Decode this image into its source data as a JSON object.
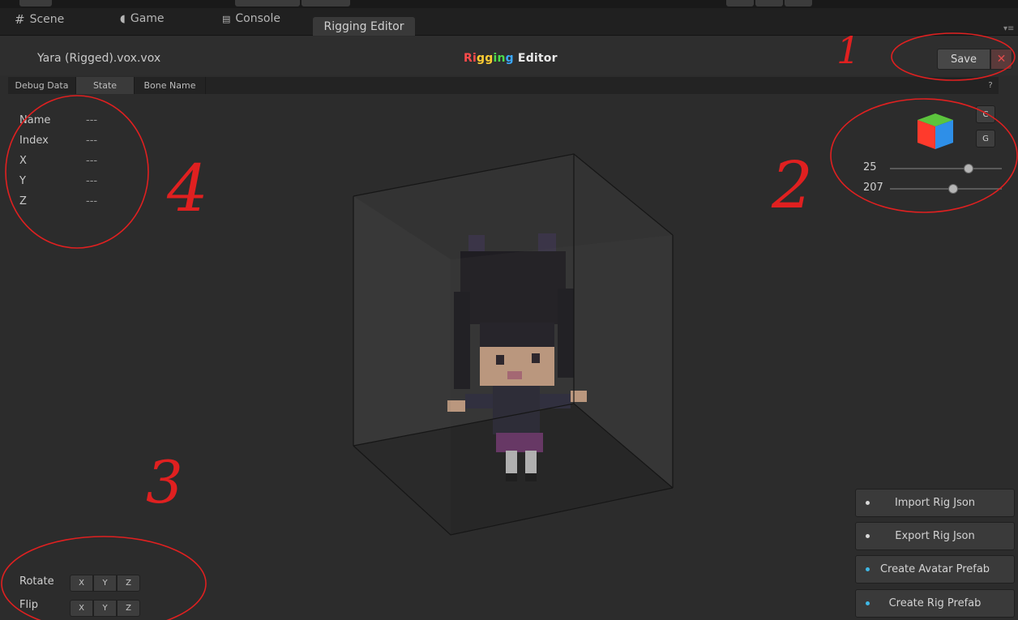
{
  "tabs": {
    "scene": "Scene",
    "game": "Game",
    "console": "Console",
    "rigging_editor": "Rigging Editor"
  },
  "header": {
    "filename": "Yara (Rigged).vox.vox",
    "title_part1": "Rigging",
    "title_part2": " Editor",
    "save_label": "Save",
    "close_label": "✕"
  },
  "subtabs": {
    "debug_data": "Debug Data",
    "state": "State",
    "bone_name": "Bone Name",
    "help": "?"
  },
  "info": {
    "name_label": "Name",
    "name_value": "---",
    "index_label": "Index",
    "index_value": "---",
    "x_label": "X",
    "x_value": "---",
    "y_label": "Y",
    "y_value": "---",
    "z_label": "Z",
    "z_value": "---"
  },
  "view_controls": {
    "c_label": "C",
    "g_label": "G",
    "slider1_value": "25",
    "slider1_level": 0.72,
    "slider2_value": "207",
    "slider2_level": 0.57
  },
  "actions": {
    "import_rig_json": "Import Rig Json",
    "export_rig_json": "Export Rig Json",
    "create_avatar_prefab": "Create Avatar Prefab",
    "create_rig_prefab": "Create Rig Prefab"
  },
  "transform": {
    "rotate_label": "Rotate",
    "flip_label": "Flip",
    "x": "X",
    "y": "Y",
    "z": "Z"
  },
  "annotations": {
    "n1": "1",
    "n2": "2",
    "n3": "3",
    "n4": "4"
  },
  "colors": {
    "rigging_gradient": [
      "#ff4b4b",
      "#ffcc33",
      "#4cdc4c",
      "#3aa8ff"
    ],
    "annotation_red": "#e02020",
    "dot_white": "#d8d8d8",
    "dot_cyan": "#3fb8e6"
  }
}
